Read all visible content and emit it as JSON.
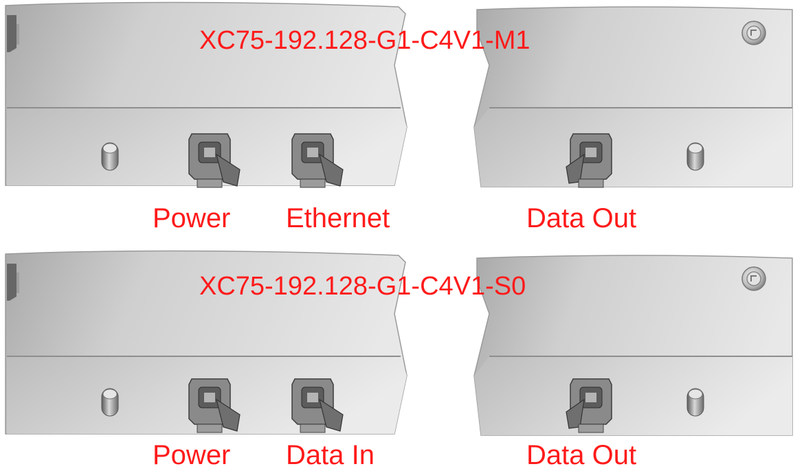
{
  "colors": {
    "label": "#ff1a1a",
    "background": "#ffffff",
    "body_light": "#e2e2e2",
    "body_dark": "#b9b9b9",
    "edge": "#8f8f8f"
  },
  "units": [
    {
      "model": "XC75-192.128-G1-C4V1-M1",
      "port_labels": [
        "Power",
        "Ethernet",
        "Data Out"
      ],
      "icons": [
        "key-lock-icon",
        "standoff-pin-icon",
        "connector-power-icon",
        "connector-ethernet-icon",
        "connector-data-out-icon",
        "standoff-pin-icon"
      ]
    },
    {
      "model": "XC75-192.128-G1-C4V1-S0",
      "port_labels": [
        "Power",
        "Data In",
        "Data Out"
      ],
      "icons": [
        "key-lock-icon",
        "standoff-pin-icon",
        "connector-power-icon",
        "connector-data-in-icon",
        "connector-data-out-icon",
        "standoff-pin-icon"
      ]
    }
  ]
}
